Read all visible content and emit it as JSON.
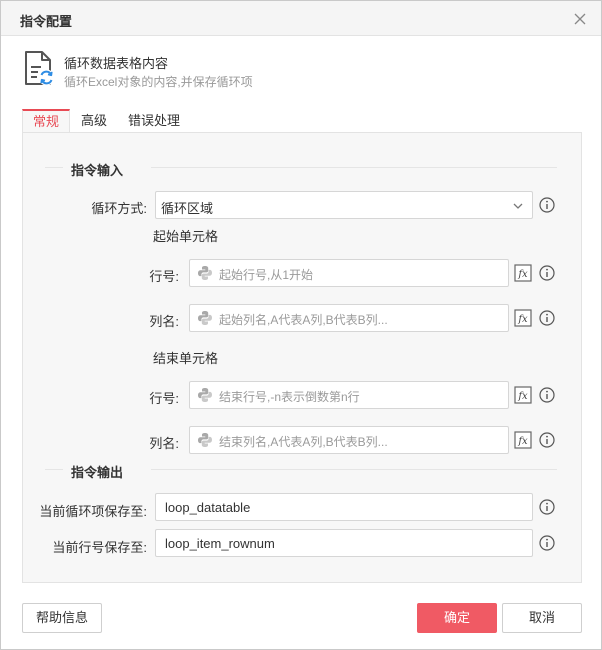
{
  "dialog": {
    "title": "指令配置"
  },
  "command": {
    "name": "循环数据表格内容",
    "description": "循环Excel对象的内容,并保存循环项"
  },
  "tabs": [
    {
      "label": "常规",
      "active": true
    },
    {
      "label": "高级",
      "active": false
    },
    {
      "label": "错误处理",
      "active": false
    }
  ],
  "input_section": {
    "title": "指令输入",
    "loop_mode": {
      "label": "循环方式:",
      "value": "循环区域"
    },
    "start_cell": {
      "title": "起始单元格",
      "row": {
        "label": "行号:",
        "placeholder": "起始行号,从1开始"
      },
      "col": {
        "label": "列名:",
        "placeholder": "起始列名,A代表A列,B代表B列..."
      }
    },
    "end_cell": {
      "title": "结束单元格",
      "row": {
        "label": "行号:",
        "placeholder": "结束行号,-n表示倒数第n行"
      },
      "col": {
        "label": "列名:",
        "placeholder": "结束列名,A代表A列,B代表B列..."
      }
    }
  },
  "output_section": {
    "title": "指令输出",
    "loop_item": {
      "label": "当前循环项保存至:",
      "value": "loop_datatable"
    },
    "row_num": {
      "label": "当前行号保存至:",
      "value": "loop_item_rownum"
    }
  },
  "footer": {
    "help_label": "帮助信息",
    "ok_label": "确定",
    "cancel_label": "取消"
  },
  "colors": {
    "accent": "#f05a64",
    "tab_active": "#e84a54",
    "panel_bg": "#f7f7f7"
  }
}
